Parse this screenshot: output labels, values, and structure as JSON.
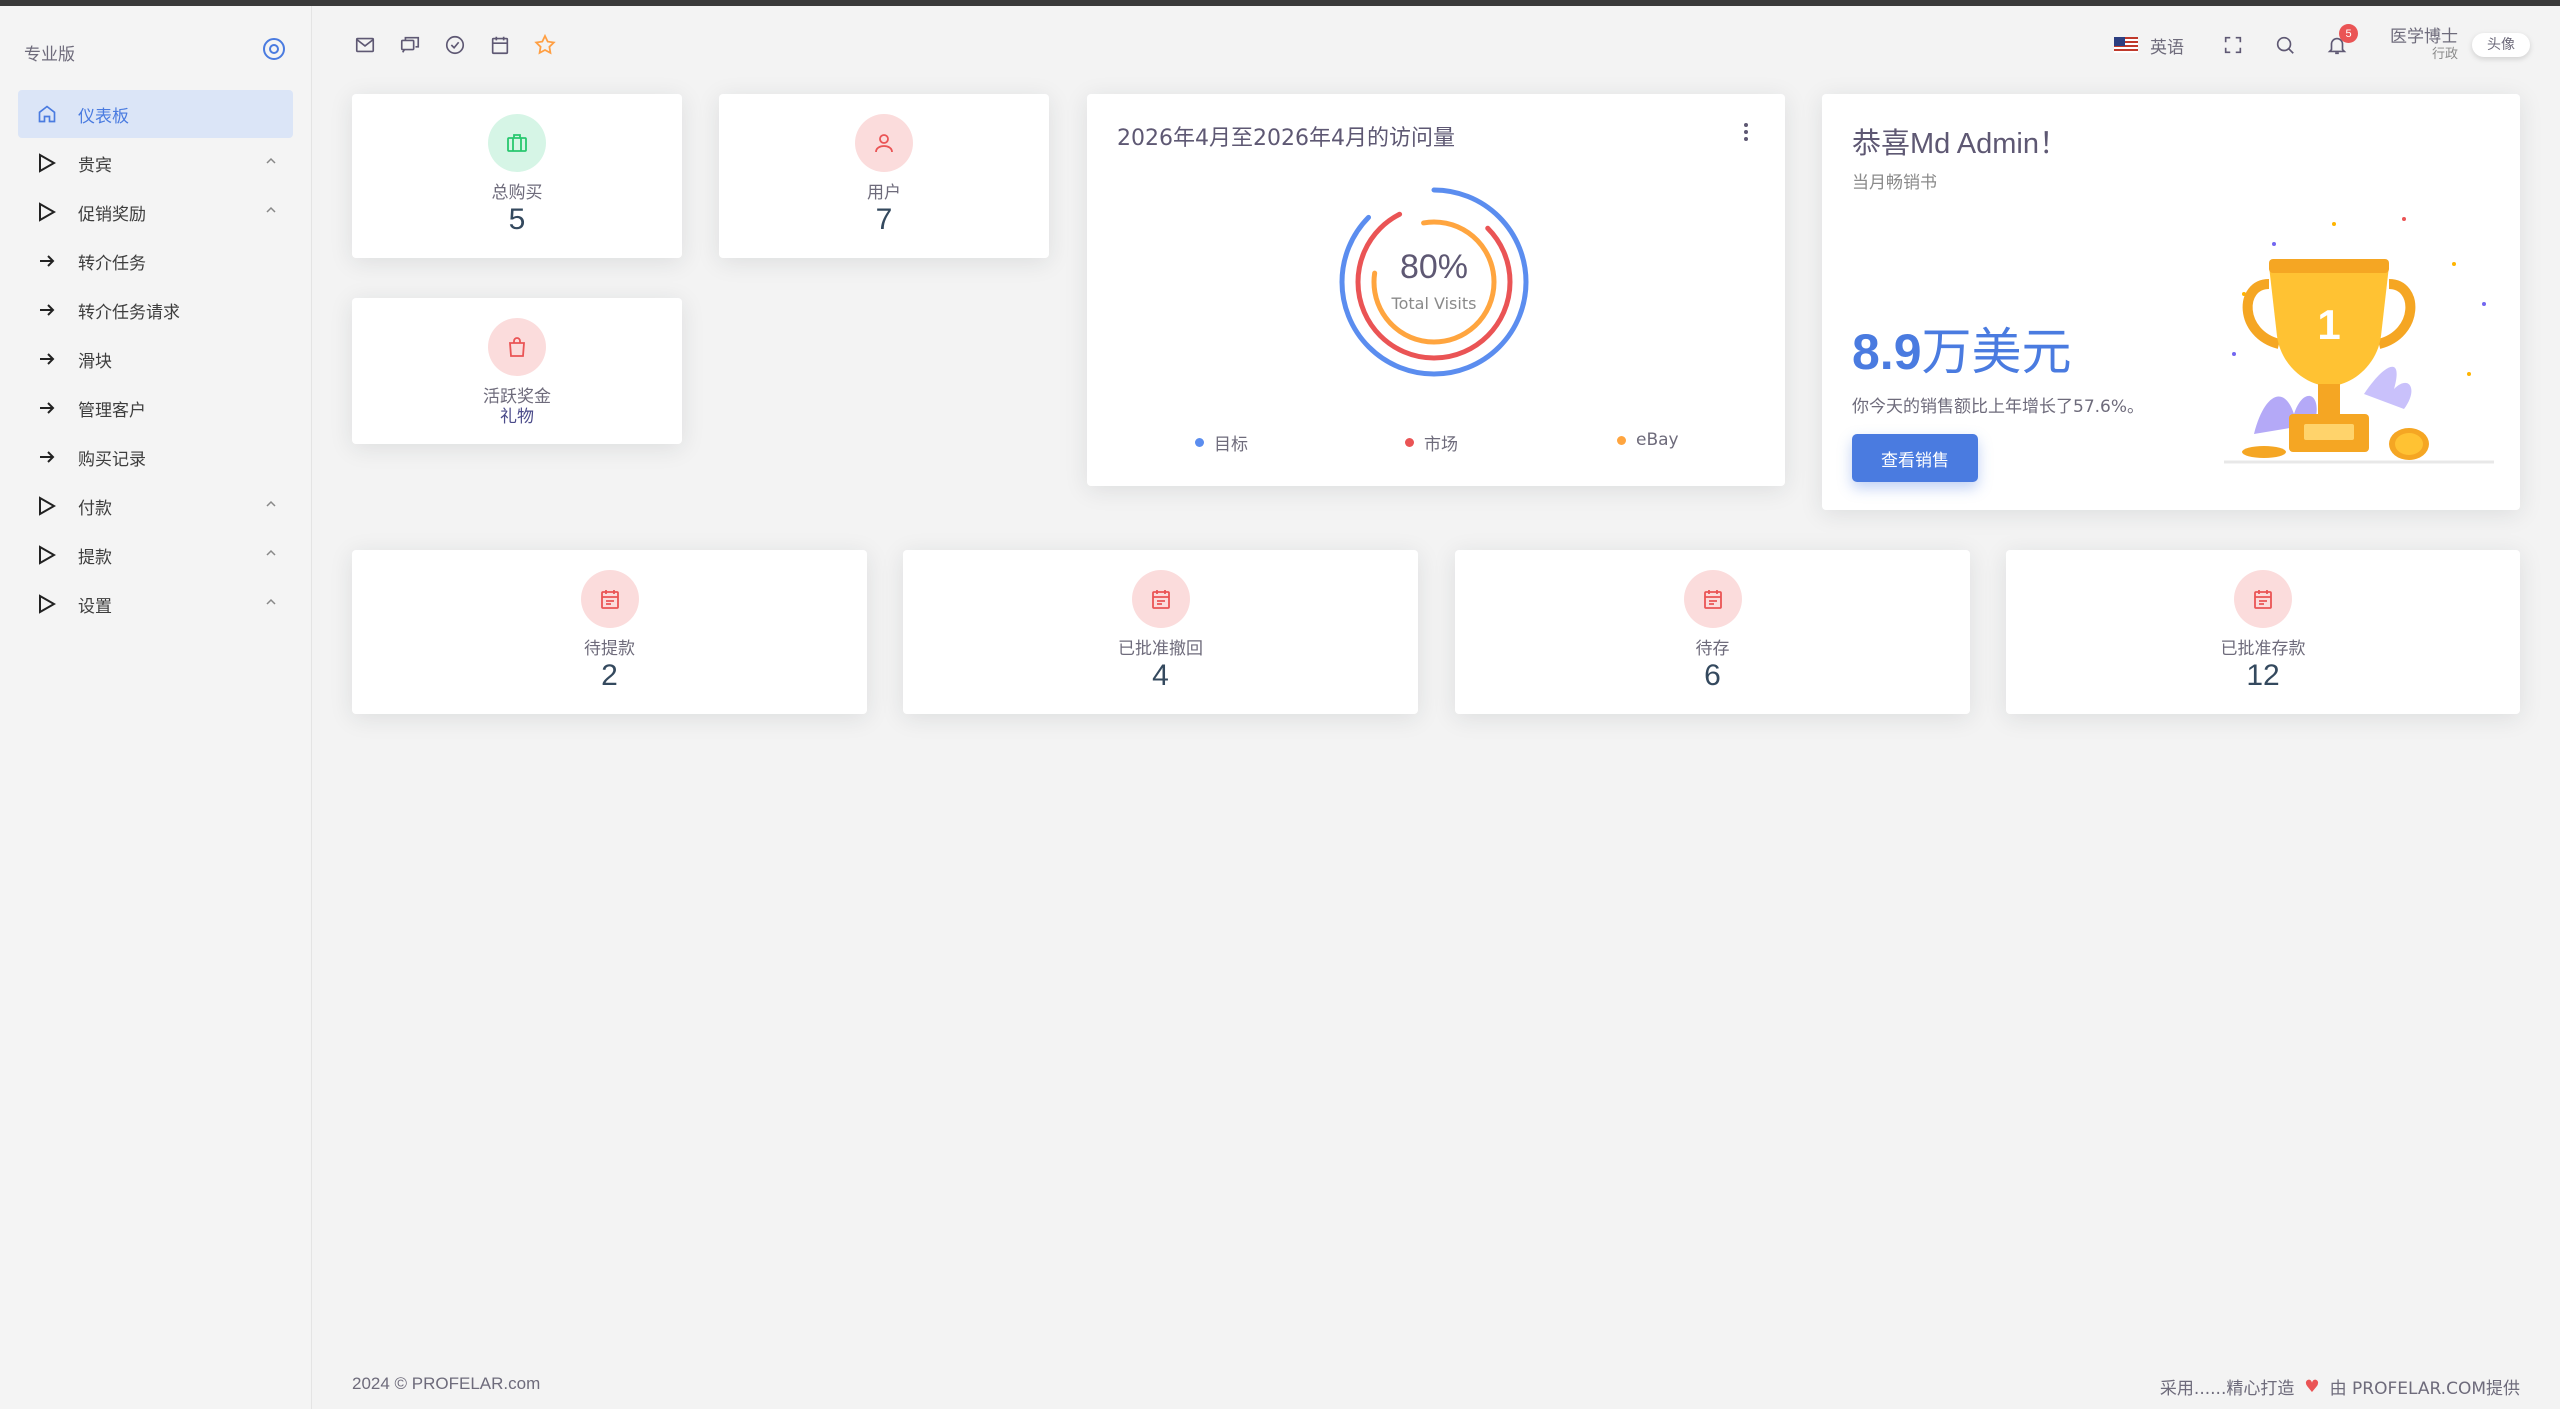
{
  "sidebar": {
    "brand": "专业版",
    "items": [
      {
        "label": "仪表板"
      },
      {
        "label": "贵宾"
      },
      {
        "label": "促销奖励"
      },
      {
        "label": "转介任务"
      },
      {
        "label": "转介任务请求"
      },
      {
        "label": "滑块"
      },
      {
        "label": "管理客户"
      },
      {
        "label": "购买记录"
      },
      {
        "label": "付款"
      },
      {
        "label": "提款"
      },
      {
        "label": "设置"
      }
    ]
  },
  "header": {
    "language": "英语",
    "notification_count": "5",
    "user_name": "医学博士",
    "user_role": "行政",
    "avatar_alt": "头像"
  },
  "stats_top": [
    {
      "label": "总购买",
      "value": "5"
    },
    {
      "label": "用户",
      "value": "7"
    },
    {
      "label": "活跃奖金",
      "value": "礼物"
    }
  ],
  "stats_bottom": [
    {
      "label": "待提款",
      "value": "2"
    },
    {
      "label": "已批准撤回",
      "value": "4"
    },
    {
      "label": "待存",
      "value": "6"
    },
    {
      "label": "已批准存款",
      "value": "12"
    }
  ],
  "visits": {
    "title": "2026年4月至2026年4月的访问量",
    "percent": "80%",
    "caption": "Total Visits",
    "legend": [
      "目标",
      "市场",
      "eBay"
    ],
    "colors": [
      "#5b8def",
      "#ea5455",
      "#ffa53f"
    ]
  },
  "congrats": {
    "title": "恭喜Md Admin！",
    "subtitle": "当月畅销书",
    "amount_num": "8.9",
    "amount_unit": "万美元",
    "description": "你今天的销售额比上年增长了57.6%。",
    "button": "查看销售"
  },
  "footer": {
    "left": "2024 © PROFELAR.com",
    "right_pre": "采用......精心打造",
    "right_post": "由 PROFELAR.COM提供"
  }
}
